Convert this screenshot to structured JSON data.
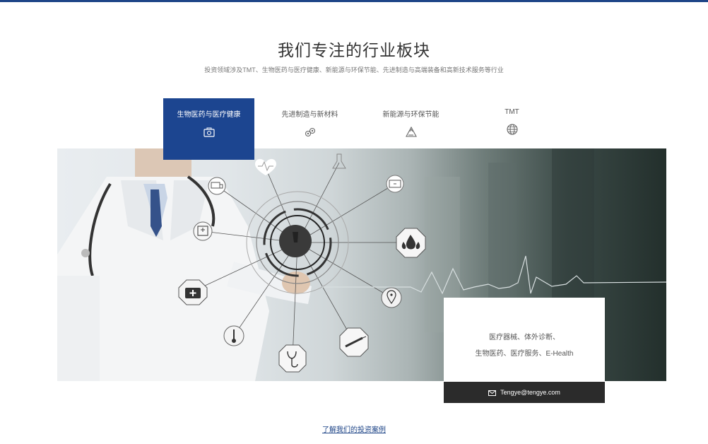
{
  "section": {
    "title": "我们专注的行业板块",
    "subtitle": "投资领域涉及TMT、生物医药与医疗健康、新能源与环保节能、先进制造与高端装备和高新技术服务等行业"
  },
  "tabs": [
    {
      "label": "生物医药与医疗健康",
      "icon": "medical-kit-icon",
      "active": true
    },
    {
      "label": "先进制造与新材料",
      "icon": "molecule-icon",
      "active": false
    },
    {
      "label": "新能源与环保节能",
      "icon": "recycle-icon",
      "active": false
    },
    {
      "label": "TMT",
      "icon": "globe-icon",
      "active": false
    }
  ],
  "hero": {
    "description_line1": "医疗器械、体外诊断、",
    "description_line2": "生物医药、医疗服务、E-Health",
    "email": "Tengye@tengye.com"
  },
  "footer_link": "了解我们的投资案例",
  "colors": {
    "accent": "#1c4590",
    "dark_bar": "#2b2b2b",
    "link": "#1d4487"
  }
}
